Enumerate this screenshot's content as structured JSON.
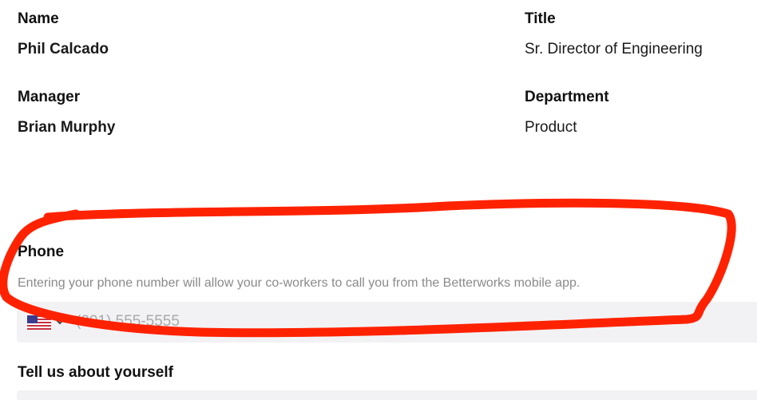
{
  "profile": {
    "name_label": "Name",
    "name_value": "Phil Calcado",
    "title_label": "Title",
    "title_value": "Sr. Director of Engineering",
    "manager_label": "Manager",
    "manager_value": "Brian Murphy",
    "department_label": "Department",
    "department_value": "Product"
  },
  "phone": {
    "label": "Phone",
    "helper": "Entering your phone number will allow your co-workers to call you from the Betterworks mobile app.",
    "placeholder": "(201) 555-5555",
    "country_icon": "us-flag-icon"
  },
  "about": {
    "label": "Tell us about yourself"
  },
  "annotation": {
    "color": "#ff2200"
  }
}
